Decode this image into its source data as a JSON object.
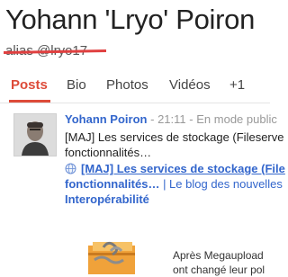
{
  "profile": {
    "name": "Yohann 'Lryo' Poiron",
    "alias": "alias @lryo17"
  },
  "tabs": [
    {
      "label": "Posts",
      "active": true
    },
    {
      "label": "Bio",
      "active": false
    },
    {
      "label": "Photos",
      "active": false
    },
    {
      "label": "Vidéos",
      "active": false
    },
    {
      "label": "+1",
      "active": false
    }
  ],
  "post": {
    "author": "Yohann Poiron",
    "separator": "-",
    "time": "21:11",
    "visibility": "En mode public",
    "text_line1": "[MAJ] Les services de stockage (Fileserve",
    "text_line2": "fonctionnalités…",
    "link_title": "[MAJ] Les services de stockage (File",
    "link_line2_a": "fonctionnalités…",
    "link_line2_b": " | Le blog des nouvelles",
    "link_line3": "Interopérabilité",
    "excerpt_line1": "Après Megaupload",
    "excerpt_line2": "ont changé leur pol"
  },
  "colors": {
    "accent": "#dd4b39",
    "link": "#3366cc"
  }
}
